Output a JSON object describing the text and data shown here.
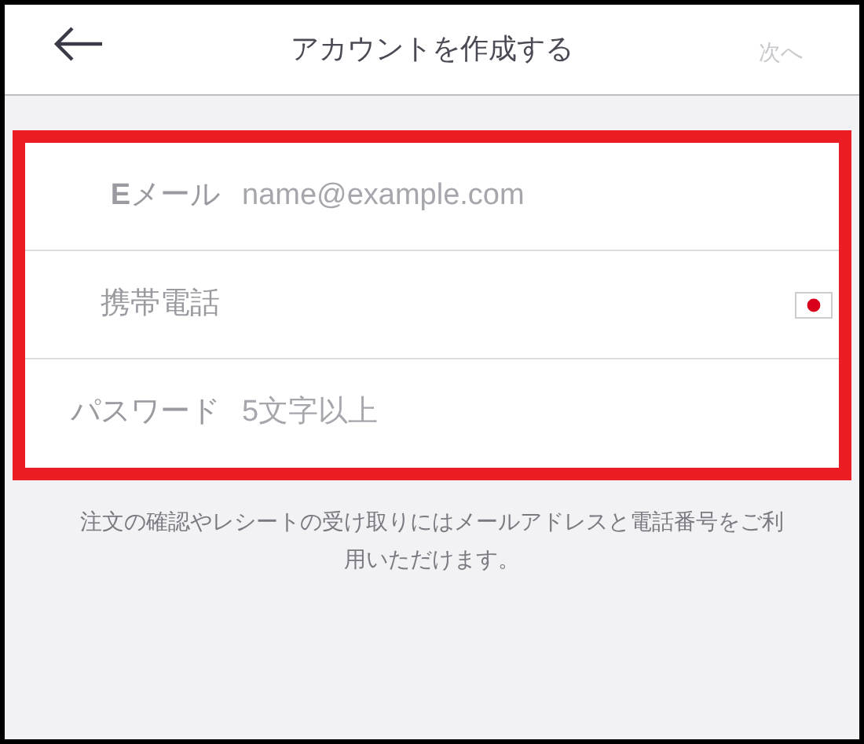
{
  "header": {
    "title": "アカウントを作成する",
    "next_button": {
      "label": "次へ",
      "disabled": true
    }
  },
  "form": {
    "fields": [
      {
        "kind": "email",
        "label": "**E**メール",
        "placeholder": "name@example.com"
      },
      {
        "kind": "phone",
        "label": "携帯電話"
      },
      {
        "kind": "password",
        "label": "パスワード",
        "placeholder": "5文字以上"
      }
    ]
  },
  "note": "注文の確認やレシートの受け取りにはメールアドレスと電話番号をご利用いただけます。"
}
